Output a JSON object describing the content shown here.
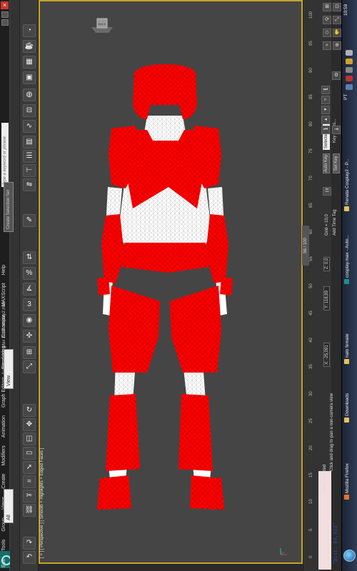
{
  "window": {
    "title": "Autodesk 3ds Max 2010  cosplay2.max",
    "close_glyph": "×"
  },
  "search": {
    "placeholder": "Type a keyword or phrase"
  },
  "menu": [
    "Edit",
    "Tools",
    "Group",
    "Views",
    "Create",
    "Modifiers",
    "Animation",
    "Graph Editors",
    "Rendering",
    "Customize",
    "MAXScript",
    "Help"
  ],
  "toolbar": {
    "view_dropdown": "View",
    "filter_dropdown": "All",
    "selection_set": "Create Selection Set",
    "snap_labels": [
      "3",
      "%"
    ]
  },
  "viewport": {
    "label": "[ + ] [ Perspective ] [ Smooth + Highlights + Edged Faces ]",
    "viewcube_label": "BACK"
  },
  "timeline": {
    "frame_counter": "56 / 100",
    "ticks": [
      "0",
      "5",
      "10",
      "15",
      "20",
      "25",
      "30",
      "35",
      "40",
      "45",
      "50",
      "55",
      "60",
      "65",
      "70",
      "75",
      "80",
      "85",
      "90",
      "95",
      "100"
    ]
  },
  "status": {
    "listener_text": "\"Dist: 84,923\"",
    "selection": "None Selected",
    "prompt": "Click and drag to pan a non-camera view",
    "x_label": "X:",
    "x_value": "-25,091",
    "y_label": "Y:",
    "y_value": "118,99",
    "z_label": "Z:",
    "z_value": "0,0",
    "grid": "Grid = 10,0",
    "add_time_tag": "Add Time Tag",
    "auto_key": "Auto Key",
    "set_key": "Set Key",
    "selected_dropdown": "Selected",
    "key_filters": "Key Filters..."
  },
  "taskbar": {
    "tasks": [
      {
        "label": "Mozilla Firefox",
        "icon_color": "#e8742a"
      },
      {
        "label": "Downloads",
        "icon_color": "#e6c25a"
      },
      {
        "label": "halo female",
        "icon_color": "#e6c25a"
      },
      {
        "label": "cosplay.max - Auto...",
        "icon_color": "#1c8f8f"
      },
      {
        "label": "Renata Cosplay2 - P...",
        "icon_color": "#e6c25a"
      }
    ],
    "language": "PT",
    "clock": "10:59"
  },
  "colors": {
    "viewport_border": "#c9a227",
    "armor": "#ff0000",
    "undersuit": "#ffffff",
    "listener_bg": "#f2dede",
    "listener_text": "#2b4ea6"
  },
  "icons": [
    "undo-icon",
    "redo-icon",
    "link-icon",
    "unlink-icon",
    "bind-icon",
    "select-icon",
    "region-select-icon",
    "window-crossing-icon",
    "move-icon",
    "rotate-icon",
    "scale-icon",
    "snap-icon",
    "angle-snap-icon",
    "percent-snap-icon",
    "mirror-icon",
    "align-icon",
    "layer-icon",
    "curve-editor-icon",
    "schematic-icon",
    "material-editor-icon",
    "render-setup-icon",
    "render-frame-icon",
    "render-icon",
    "key-icon",
    "play-icon",
    "zoom-icon",
    "pan-icon",
    "orbit-icon",
    "maximize-icon"
  ]
}
